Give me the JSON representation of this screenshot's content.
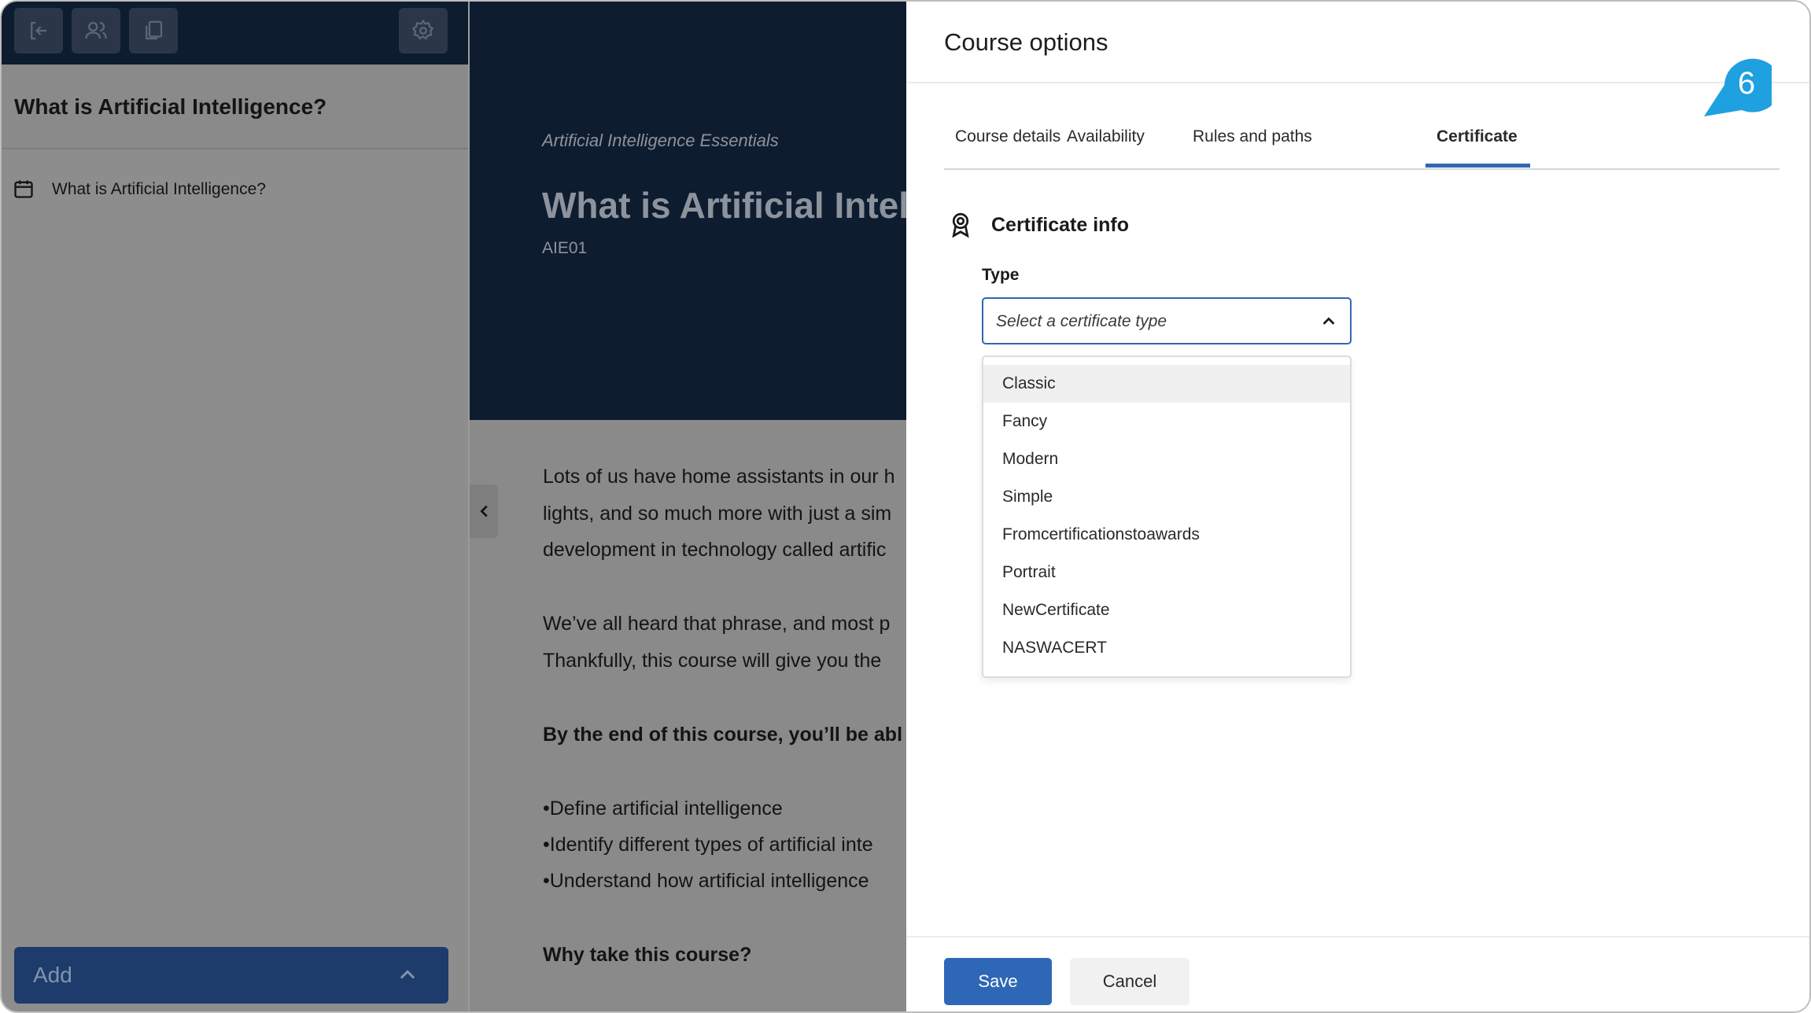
{
  "sidebar": {
    "title": "What is Artificial Intelligence?",
    "items": [
      {
        "label": "What is Artificial Intelligence?",
        "icon": "calendar-icon"
      }
    ],
    "add_label": "Add"
  },
  "content": {
    "course_subtitle": "Artificial Intelligence Essentials",
    "course_title": "What is Artificial Intell",
    "course_code": "AIE01",
    "lines": [
      "Lots of us have home assistants in our h",
      "lights, and so much more with just a sim",
      "development in technology called artific",
      "We’ve all heard that phrase, and most p",
      "Thankfully, this course will give you the",
      "By the end of this course, you’ll be abl",
      "•Define artificial intelligence",
      "•Identify different types of artificial inte",
      "•Understand how artificial intelligence",
      "Why take this course?"
    ]
  },
  "panel": {
    "title": "Course options",
    "tabs": [
      {
        "label": "Course details"
      },
      {
        "label": "Availability"
      },
      {
        "label": "Rules and paths"
      },
      {
        "label": "Certificate"
      }
    ],
    "active_tab": "Certificate",
    "step_number": "6",
    "section_title": "Certificate info",
    "type_label": "Type",
    "select_placeholder": "Select a certificate type",
    "options": [
      "Classic",
      "Fancy",
      "Modern",
      "Simple",
      "Fromcertificationstoawards",
      "Portrait",
      "NewCertificate",
      "NASWACERT"
    ],
    "save_label": "Save",
    "cancel_label": "Cancel"
  },
  "colors": {
    "accent": "#2f67b7",
    "badge": "#1fa0e0",
    "navy": "#0e1c30"
  }
}
